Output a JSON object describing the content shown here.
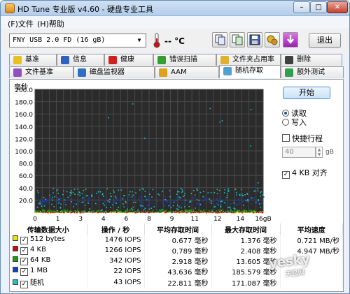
{
  "window": {
    "title": "HD Tune 专业版 v4.60 - 硬盘专业工具"
  },
  "menu": [
    "(F)文件",
    "(H)帮助"
  ],
  "toolbar": {
    "drive": "FNY     USB 2.0 FD        (16 gB)",
    "temperature": "-- °C",
    "exit_label": "退出",
    "icons": [
      "copy-info-icon",
      "copy-screen-icon",
      "save-icon",
      "settings-icon",
      "download-icon"
    ]
  },
  "tabs_row1": [
    {
      "label": "基准",
      "icon": "benchmark-icon"
    },
    {
      "label": "信息",
      "icon": "info-icon"
    },
    {
      "label": "健康",
      "icon": "health-icon"
    },
    {
      "label": "错误扫描",
      "icon": "error-scan-icon"
    },
    {
      "label": "文件夹占用率",
      "icon": "folder-usage-icon"
    },
    {
      "label": "删除",
      "icon": "erase-icon"
    }
  ],
  "tabs_row2": [
    {
      "label": "文件基准",
      "icon": "file-benchmark-icon"
    },
    {
      "label": "磁盘监视器",
      "icon": "disk-monitor-icon"
    },
    {
      "label": "AAM",
      "icon": "aam-icon"
    },
    {
      "label": "随机存取",
      "icon": "random-access-icon",
      "active": true
    },
    {
      "label": "额外测试",
      "icon": "extra-tests-icon"
    }
  ],
  "chart_data": {
    "type": "scatter",
    "ylabel": "毫秒",
    "xlabel": "",
    "ylim": [
      0,
      200
    ],
    "xlim": [
      0,
      16
    ],
    "y_ticks": [
      "200.0",
      "180.0",
      "160.0",
      "140.0",
      "120.0",
      "100.0",
      "80.0",
      "60.0",
      "40.0",
      "20.0"
    ],
    "x_ticks": [
      "0",
      "1",
      "3",
      "4",
      "6",
      "8",
      "9",
      "11",
      "12",
      "14",
      "16gB"
    ],
    "grid": true,
    "series": [
      {
        "name": "512 bytes",
        "color": "#e6e600",
        "band": [
          0,
          2
        ]
      },
      {
        "name": "4 KB",
        "color": "#c01010",
        "band": [
          0,
          2
        ]
      },
      {
        "name": "64 KB",
        "color": "#10a010",
        "band": [
          1,
          5
        ]
      },
      {
        "name": "1 MB",
        "color": "#1040d0",
        "band": [
          12,
          26
        ]
      },
      {
        "name": "随机",
        "color": "#20c0c0",
        "band": [
          2,
          40
        ]
      }
    ]
  },
  "controls": {
    "start_label": "开始",
    "read_label": "读取",
    "write_label": "写入",
    "quick_label": "快捷行程",
    "quick_value": "40",
    "quick_unit": "gB",
    "align_label": "4 KB 对齐"
  },
  "results": {
    "headers": [
      "传输数据大小",
      "操作 / 秒",
      "平均存取时间",
      "最大存取时间",
      "平均速度"
    ],
    "rows": [
      {
        "size": "512 bytes",
        "color": "#e6e600",
        "ops": "1476",
        "ops_unit": "IOPS",
        "avg": "0.677",
        "avg_unit": "毫秒",
        "max": "1.376",
        "max_unit": "毫秒",
        "speed": "0.721 MB/秒"
      },
      {
        "size": "4 KB",
        "color": "#c01010",
        "ops": "1266",
        "ops_unit": "IOPS",
        "avg": "0.789",
        "avg_unit": "毫秒",
        "max": "2.408",
        "max_unit": "毫秒",
        "speed": "4.947 MB/秒"
      },
      {
        "size": "64 KB",
        "color": "#10a010",
        "ops": "342",
        "ops_unit": "IOPS",
        "avg": "2.918",
        "avg_unit": "毫秒",
        "max": "13.605",
        "max_unit": "毫秒",
        "speed": ""
      },
      {
        "size": "1 MB",
        "color": "#1040d0",
        "ops": "22",
        "ops_unit": "IOPS",
        "avg": "43.636",
        "avg_unit": "毫秒",
        "max": "185.579",
        "max_unit": "毫秒",
        "speed": ""
      },
      {
        "size": "随机",
        "color": "#20c0c0",
        "ops": "43",
        "ops_unit": "IOPS",
        "avg": "22.811",
        "avg_unit": "毫秒",
        "max": "171.087",
        "max_unit": "毫秒",
        "speed": ""
      }
    ]
  },
  "watermark": {
    "text": "yesky",
    "sub": "天极网"
  }
}
